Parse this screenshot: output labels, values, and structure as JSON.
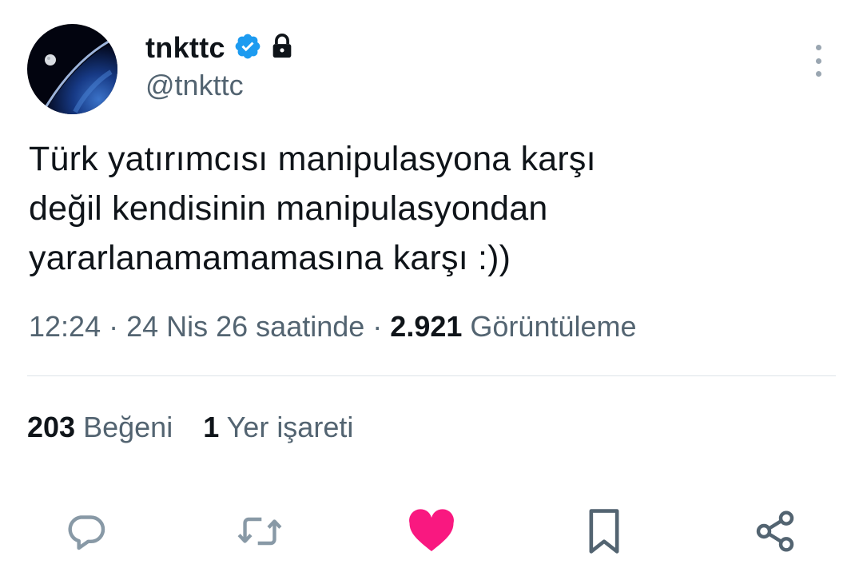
{
  "author": {
    "display_name": "tnkttc",
    "handle": "@tnkttc",
    "verified": true,
    "protected": true
  },
  "tweet": {
    "lines": [
      "Türk yatırımcısı manipulasyona karşı",
      "değil kendisinin manipulasyondan",
      "yararlanamamamasına karşı :))"
    ]
  },
  "meta": {
    "time": "12:24",
    "separator": " · ",
    "date": "24 Nis 26 saatinde",
    "views_count": "2.921",
    "views_label": "Görüntüleme"
  },
  "stats": {
    "likes_count": "203",
    "likes_label": "Beğeni",
    "bookmarks_count": "1",
    "bookmarks_label": "Yer işareti"
  },
  "colors": {
    "text": "#0f1419",
    "secondary": "#536471",
    "verified": "#1d9bf0",
    "liked": "#f91880",
    "action_gray": "#8899a6",
    "divider": "#dde3e8"
  },
  "icons": {
    "more": "more-vertical-icon",
    "reply": "reply-icon",
    "retweet": "retweet-icon",
    "like": "heart-icon",
    "bookmark": "bookmark-icon",
    "share": "share-icon"
  }
}
